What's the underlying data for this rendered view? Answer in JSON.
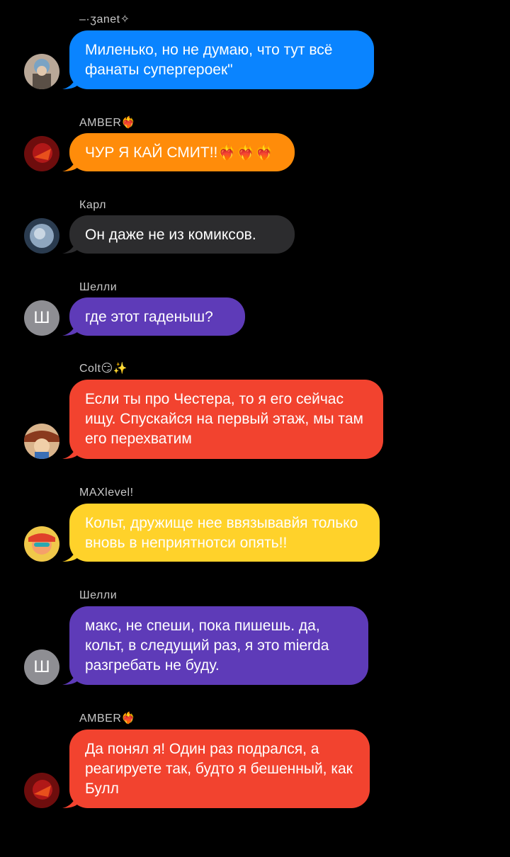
{
  "messages": [
    {
      "sender": "–·ʒanet✧",
      "text": "Миленько, но не думаю, что тут всё фанаты супергероек\"",
      "color": "#0a84ff",
      "avatar": "photo"
    },
    {
      "sender": "AMBER❤️‍🔥",
      "text": "ЧУР Я КАЙ СМИТ!!❤️‍🔥❤️‍🔥❤️‍🔥",
      "color": "#ff8c0a",
      "avatar": "photo"
    },
    {
      "sender": "Карл",
      "text": "Он даже не из комиксов.",
      "color": "#2c2c2e",
      "avatar": "photo"
    },
    {
      "sender": "Шелли",
      "text": "где этот гаденыш?",
      "color": "#5e3bb8",
      "avatar": "Ш"
    },
    {
      "sender": "Colt😏✨",
      "text": "Если ты про Честера, то я его сейчас ищу. Спускайся на первый этаж, мы там его перехватим",
      "color": "#f2432f",
      "avatar": "photo"
    },
    {
      "sender": "MAXlevel!",
      "text": "Кольт, дружище нее ввязывавйя только вновь в неприятнотси опять!!",
      "color": "#ffd22a",
      "avatar": "photo"
    },
    {
      "sender": "Шелли",
      "text": "макс, не спеши, пока пишешь. да, кольт, в следущий раз, я это mierda разгребать не буду.",
      "color": "#5e3bb8",
      "avatar": "Ш"
    },
    {
      "sender": "AMBER❤️‍🔥",
      "text": "Да понял я! Один раз подрался, а реагируете так, будто я бешенный, как Булл",
      "color": "#f2432f",
      "avatar": "photo"
    }
  ]
}
